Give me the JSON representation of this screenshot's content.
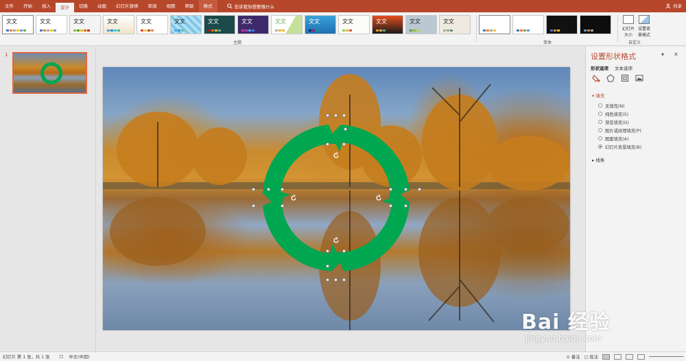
{
  "ribbon_tabs": [
    "文件",
    "开始",
    "插入",
    "设计",
    "切换",
    "动画",
    "幻灯片放映",
    "审阅",
    "视图",
    "帮助",
    "格式"
  ],
  "active_tab": "设计",
  "tell_me": "告诉我你想要做什么",
  "share": "共享",
  "themes": {
    "items": [
      "文文",
      "文文",
      "文文",
      "文文",
      "文文",
      "文文",
      "文文",
      "文文",
      "文文",
      "文文",
      "文文",
      "文文",
      "文文",
      "文文"
    ],
    "group_label": "主题"
  },
  "variants": {
    "group_label": "变体"
  },
  "customize": {
    "slide_size": "幻灯片大小",
    "format_background": "设置背景格式",
    "group_label": "自定义"
  },
  "thumbnail": {
    "number": "1"
  },
  "format_pane": {
    "title": "设置形状格式",
    "tabs": [
      "形状选项",
      "文本选项"
    ],
    "fill_section": "填充",
    "fill_options": [
      {
        "label": "无填充(N)",
        "selected": false
      },
      {
        "label": "纯色填充(S)",
        "selected": false
      },
      {
        "label": "渐变填充(G)",
        "selected": false
      },
      {
        "label": "图片或纹理填充(P)",
        "selected": false
      },
      {
        "label": "图案填充(A)",
        "selected": false
      },
      {
        "label": "幻灯片背景填充(B)",
        "selected": true
      }
    ],
    "line_section": "线条"
  },
  "status": {
    "slide_info": "幻灯片 第 1 张，共 1 张",
    "language": "中文(中国)",
    "notes": "备注",
    "comments": "批注"
  },
  "colors": {
    "accent": "#b7472a",
    "shape_fill": "#00a650"
  },
  "watermark": {
    "brand": "Bai 经验",
    "url": "jingyan.baidu.com"
  }
}
